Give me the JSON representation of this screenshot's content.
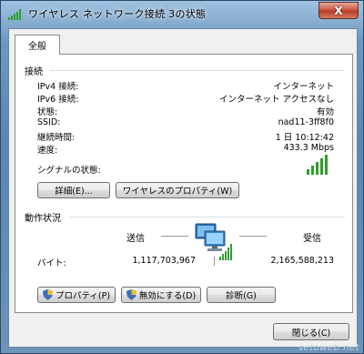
{
  "window": {
    "title": "ワイヤレス ネットワーク接続 3の状態",
    "close_label": "X"
  },
  "tab": {
    "label": "全般"
  },
  "connection": {
    "heading": "接続",
    "rows": [
      {
        "label": "IPv4 接続:",
        "value": "インターネット"
      },
      {
        "label": "IPv6 接続:",
        "value": "インターネット アクセスなし"
      },
      {
        "label": "状態:",
        "value": "有効"
      },
      {
        "label": "SSID:",
        "value": "nad11-3ff8f0"
      },
      {
        "label": "継続時間:",
        "value": "1 日  10:12:42"
      },
      {
        "label": "速度:",
        "value": "433.3 Mbps"
      }
    ],
    "signal_label": "シグナルの状態:",
    "signal_level": 5,
    "signal_max": 5
  },
  "buttons_top": {
    "details": "詳細(E)...",
    "wireless_props": "ワイヤレスのプロパティ(W)"
  },
  "activity": {
    "heading": "動作状況",
    "sent_label": "送信",
    "received_label": "受信",
    "bytes_label": "バイト:",
    "sent_bytes": "1,117,703,967",
    "received_bytes": "2,165,588,213"
  },
  "buttons_bottom": {
    "properties": "プロパティ(P)",
    "disable": "無効にする(D)",
    "diagnose": "診断(G)"
  },
  "footer": {
    "close": "閉じる(C)"
  },
  "watermark": "setoweb.net",
  "colors": {
    "signal_green": "#2f9e2f",
    "accent": "#3c7fb1"
  }
}
